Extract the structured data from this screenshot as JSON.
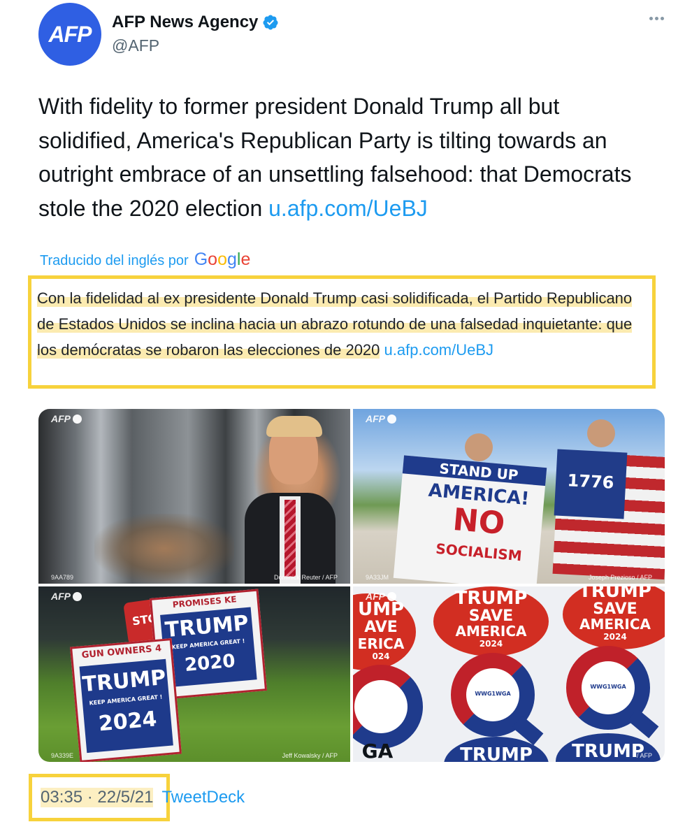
{
  "author": {
    "display_name": "AFP News Agency",
    "handle": "@AFP",
    "avatar_text": "AFP",
    "verified": true,
    "avatar_color": "#2f5fe3"
  },
  "tweet": {
    "text": "With fidelity to former president Donald Trump all but solidified, America's Republican Party is tilting towards an outright embrace of an unsettling falsehood: that Democrats stole the 2020 election",
    "link": "u.afp.com/UeBJ"
  },
  "translation": {
    "label": "Traducido del inglés por",
    "provider": "Google",
    "text": "Con la fidelidad al ex presidente Donald Trump casi solidificada, el Partido Republicano de Estados Unidos se inclina hacia un abrazo rotundo de una falsedad inquietante: que los demócratas se robaron las elecciones de 2020",
    "link": "u.afp.com/UeBJ"
  },
  "media": [
    {
      "watermark": "AFP",
      "photo_id": "9AA789",
      "credit": "Dominick Reuter / AFP"
    },
    {
      "watermark": "AFP",
      "photo_id": "9A33JM",
      "credit": "Joseph Prezioso / AFP",
      "sign_lines": [
        "STAND UP",
        "AMERICA!",
        "NO",
        "SOCIALISM"
      ],
      "flag_text": "1776"
    },
    {
      "watermark": "AFP",
      "photo_id": "9A339E",
      "credit": "Jeff Kowalsky / AFP",
      "back_sign": {
        "top": "PROMISES KE",
        "name": "TRUMP",
        "slogan": "KEEP AMERICA GREAT !",
        "year": "2020"
      },
      "front_sign": {
        "top": "GUN OWNERS 4",
        "name": "TRUMP",
        "slogan": "KEEP AMERICA GREAT !",
        "year": "2024"
      },
      "stop_text": "STO"
    },
    {
      "watermark": "AFP",
      "credit": "/ AFP",
      "sticker_lines": [
        "TRUMP",
        "SAVE",
        "AMERICA",
        "2024"
      ],
      "partial_sticker_lines": [
        "UMP",
        "AVE",
        "ERICA",
        "024"
      ],
      "bottom_texts": [
        "GA",
        "TRUMP",
        "TRUMP"
      ],
      "q_label": "WWG1WGA"
    }
  ],
  "footer": {
    "timestamp": "03:35 · 22/5/21",
    "source": "TweetDeck"
  },
  "colors": {
    "link": "#1d9bf0",
    "highlight_box": "#f7d23c",
    "secondary_text": "#536471"
  }
}
